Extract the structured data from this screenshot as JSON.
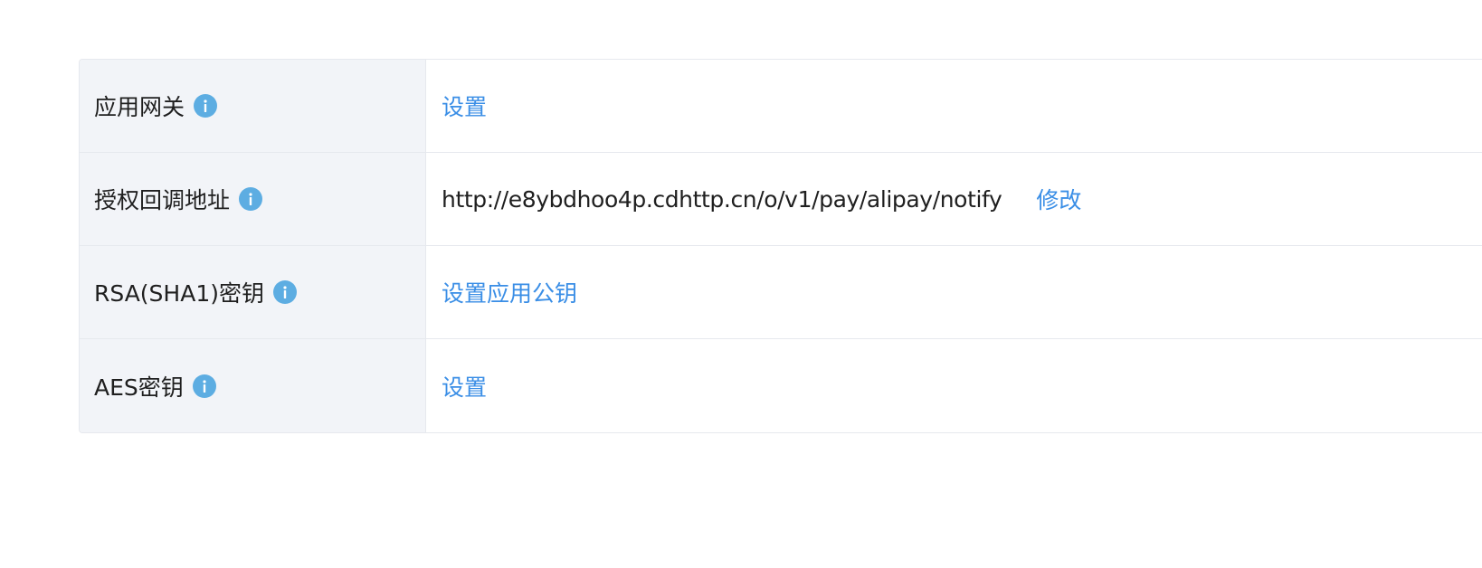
{
  "rows": [
    {
      "label": "应用网关",
      "icon": "info-icon",
      "action_label": "设置"
    },
    {
      "label": "授权回调地址",
      "icon": "info-icon",
      "value": "http://e8ybdhoo4p.cdhttp.cn/o/v1/pay/alipay/notify",
      "action_label": "修改"
    },
    {
      "label": "RSA(SHA1)密钥",
      "icon": "info-icon",
      "action_label": "设置应用公钥"
    },
    {
      "label": "AES密钥",
      "icon": "info-icon",
      "action_label": "设置"
    }
  ],
  "colors": {
    "link": "#3a8ee6",
    "info_icon": "#5dade2",
    "label_bg": "#f2f4f8",
    "border": "#e6e9ee"
  }
}
